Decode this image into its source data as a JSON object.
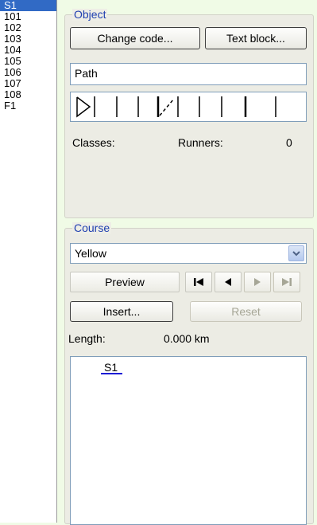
{
  "codes": [
    "S1",
    "101",
    "102",
    "103",
    "104",
    "105",
    "106",
    "107",
    "108",
    "F1"
  ],
  "object": {
    "title": "Object",
    "change_code_label": "Change code...",
    "text_block_label": "Text block...",
    "name_value": "Path",
    "classes_label": "Classes:",
    "runners_label": "Runners:",
    "runners_value": "0"
  },
  "course": {
    "title": "Course",
    "selected": "Yellow",
    "preview_label": "Preview",
    "insert_label": "Insert...",
    "reset_label": "Reset",
    "length_label": "Length:",
    "length_value": "0.000 km",
    "list_items": [
      "S1"
    ]
  },
  "colors": {
    "accent": "#316ac5",
    "title": "#1f3fb0",
    "background": "#f0fbe6"
  },
  "icons": [
    "symbol-start-icon",
    "symbol-slash-icon",
    "first-icon",
    "prev-icon",
    "next-icon",
    "last-icon",
    "dropdown-arrow-icon"
  ]
}
